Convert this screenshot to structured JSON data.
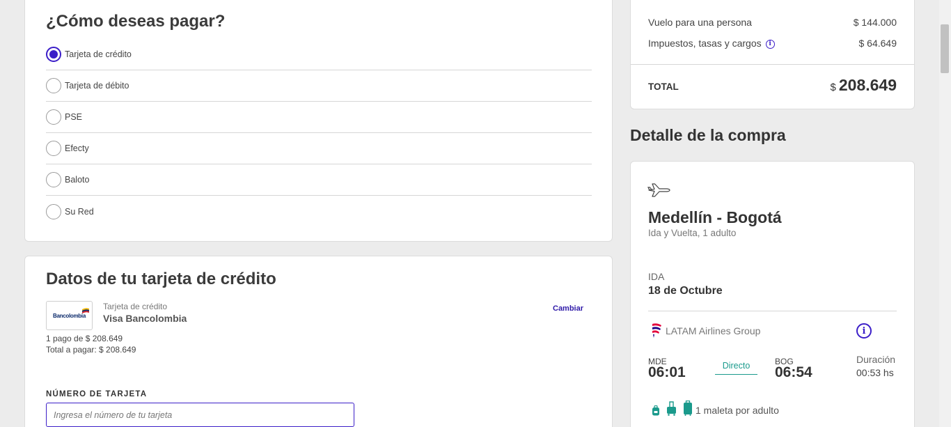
{
  "payment": {
    "title": "¿Cómo deseas pagar?",
    "options": [
      {
        "label": "Tarjeta de crédito",
        "selected": true
      },
      {
        "label": "Tarjeta de débito",
        "selected": false
      },
      {
        "label": "PSE",
        "selected": false
      },
      {
        "label": "Efecty",
        "selected": false
      },
      {
        "label": "Baloto",
        "selected": false
      },
      {
        "label": "Su Red",
        "selected": false
      }
    ]
  },
  "card_data": {
    "title": "Datos de tu tarjeta de crédito",
    "bank_logo_text": "Bancolombia",
    "card_type": "Tarjeta de crédito",
    "card_name": "Visa Bancolombia",
    "change_label": "Cambiar",
    "installments": "1 pago de $ 208.649",
    "total_to_pay": "Total a pagar: $ 208.649",
    "card_number_label": "NÚMERO DE TARJETA",
    "card_number_placeholder": "Ingresa el número de tu tarjeta",
    "card_number_value": ""
  },
  "summary": {
    "flight_label": "Vuelo para una persona",
    "flight_value": "$ 144.000",
    "taxes_label": "Impuestos, tasas y cargos",
    "taxes_value": "$ 64.649",
    "total_label": "TOTAL",
    "total_currency": "$",
    "total_value": "208.649"
  },
  "detail": {
    "title": "Detalle de la compra",
    "route": "Medellín - Bogotá",
    "trip_type": "Ida y Vuelta, 1 adulto",
    "leg_label": "IDA",
    "leg_date": "18 de Octubre",
    "airline": "LATAM Airlines Group",
    "departure_code": "MDE",
    "departure_time": "06:01",
    "flight_type": "Directo",
    "arrival_code": "BOG",
    "arrival_time": "06:54",
    "duration_label": "Duración",
    "duration_value": "00:53 hs",
    "baggage": "1 maleta por adulto"
  },
  "colors": {
    "accent": "#3b1ec8",
    "direct": "#1a9a8c",
    "baggage": "#1a9a8c"
  },
  "icons": {
    "info": "i",
    "plane": "plane-icon",
    "bags": [
      "backpack-icon",
      "carry-on-icon",
      "suitcase-icon"
    ]
  }
}
